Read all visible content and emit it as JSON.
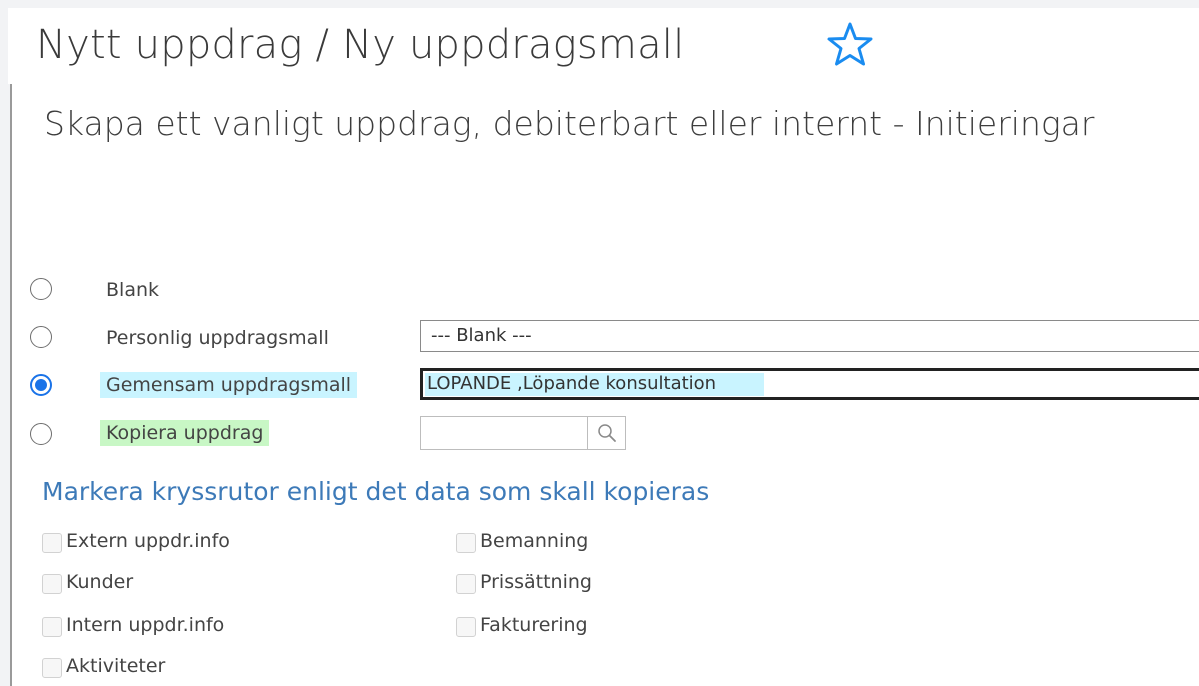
{
  "header": {
    "title": "Nytt uppdrag / Ny uppdragsmall",
    "favorite_icon": "star-outline-icon",
    "accent_color": "#1a73e8"
  },
  "main": {
    "heading": "Skapa ett vanligt uppdrag, debiterbart eller internt - Initieringar",
    "options": [
      {
        "label": "Blank",
        "selected": false
      },
      {
        "label": "Personlig uppdragsmall",
        "selected": false,
        "select_value": "--- Blank ---"
      },
      {
        "label": "Gemensam uppdragsmall",
        "selected": true,
        "select_value": "LOPANDE ,Löpande konsultation"
      },
      {
        "label": "Kopiera uppdrag",
        "selected": false,
        "input_value": ""
      }
    ],
    "copy_heading": "Markera kryssrutor enligt det data som skall kopieras",
    "copy_checkboxes": [
      {
        "label": "Extern uppdr.info",
        "checked": false
      },
      {
        "label": "Kunder",
        "checked": false
      },
      {
        "label": "Intern uppdr.info",
        "checked": false
      },
      {
        "label": "Aktiviteter",
        "checked": false
      },
      {
        "label": "Bemanning",
        "checked": false
      },
      {
        "label": "Prissättning",
        "checked": false
      },
      {
        "label": "Fakturering",
        "checked": false
      }
    ]
  }
}
